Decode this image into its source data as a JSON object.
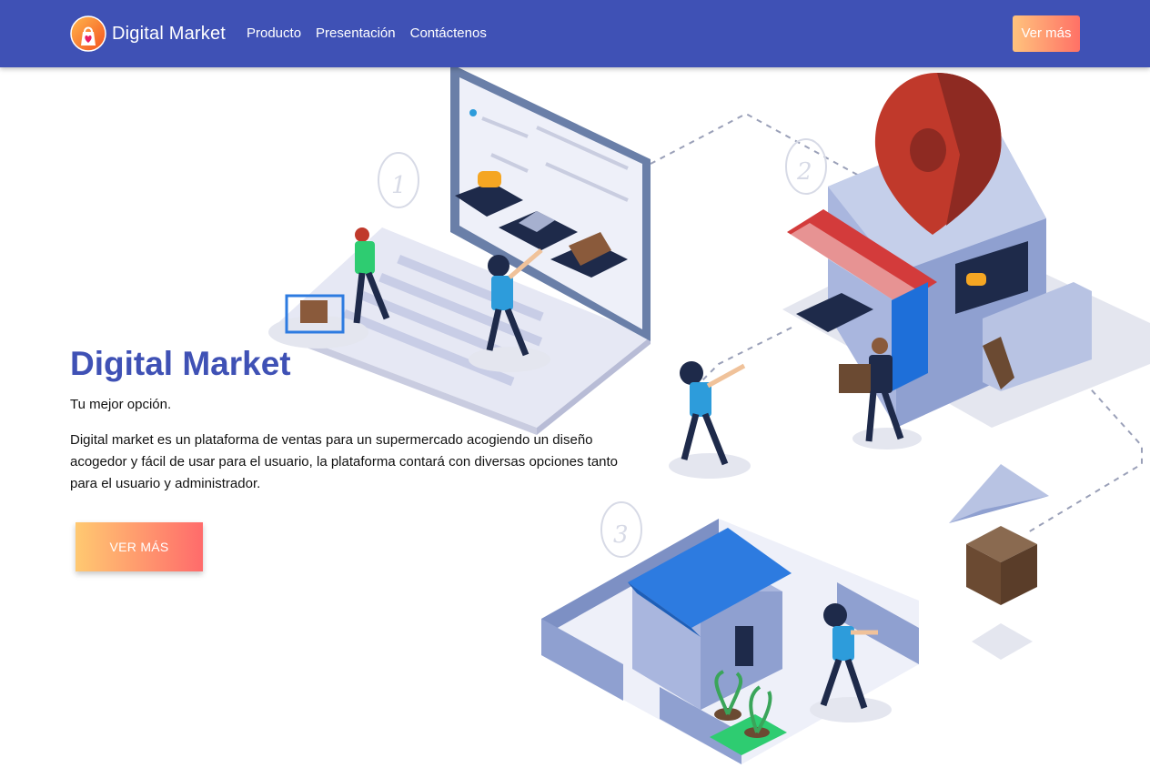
{
  "navbar": {
    "brand": "Digital Market",
    "links": [
      "Producto",
      "Presentación",
      "Contáctenos"
    ],
    "button": "Ver más"
  },
  "hero": {
    "title": "Digital Market",
    "subtitle": "Tu mejor opción.",
    "description": "Digital market es un plataforma de ventas para un supermercado acogiendo un diseño acogedor y fácil de usar para el usuario, la plataforma contará con diversas opciones tanto para el usuario y administrador.",
    "button": "VER MÁS"
  },
  "illustration": {
    "step_numbers": [
      "1",
      "2",
      "3"
    ]
  },
  "colors": {
    "primary": "#3f51b5",
    "gradient_start": "#ffc971",
    "gradient_end": "#ff6b6b"
  }
}
